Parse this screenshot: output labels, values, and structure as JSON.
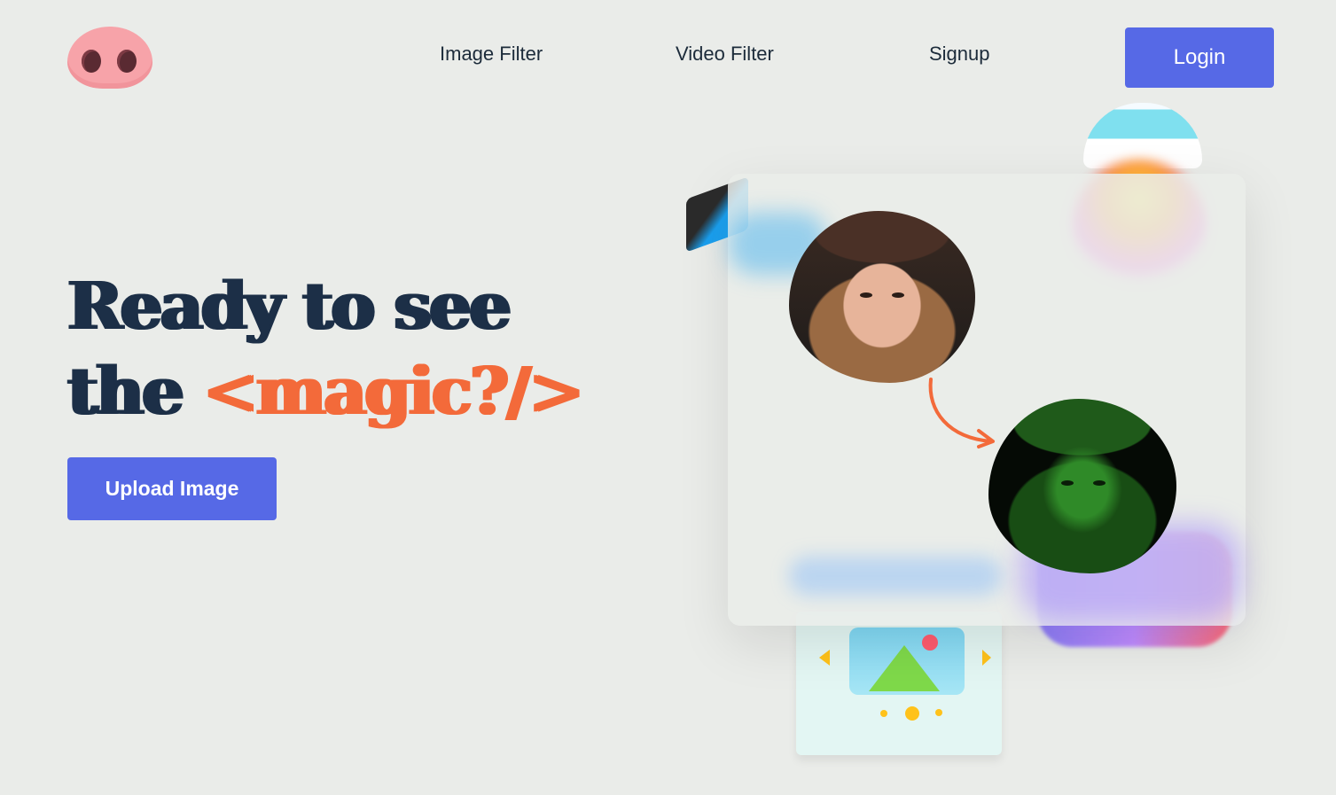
{
  "nav": {
    "logo_label": "pig-nose-logo",
    "links": [
      "Image Filter",
      "Video Filter",
      "Signup"
    ],
    "login_label": "Login"
  },
  "hero": {
    "line1": "Ready to see",
    "line2_prefix": "the ",
    "line2_highlight": "<magic?/>",
    "upload_label": "Upload Image"
  },
  "illustration": {
    "original_image": "portrait-original",
    "filtered_image": "portrait-green-filtered"
  },
  "colors": {
    "background": "#eaece9",
    "primary": "#5669e6",
    "headline": "#1c2f47",
    "accent": "#f36a3a"
  }
}
